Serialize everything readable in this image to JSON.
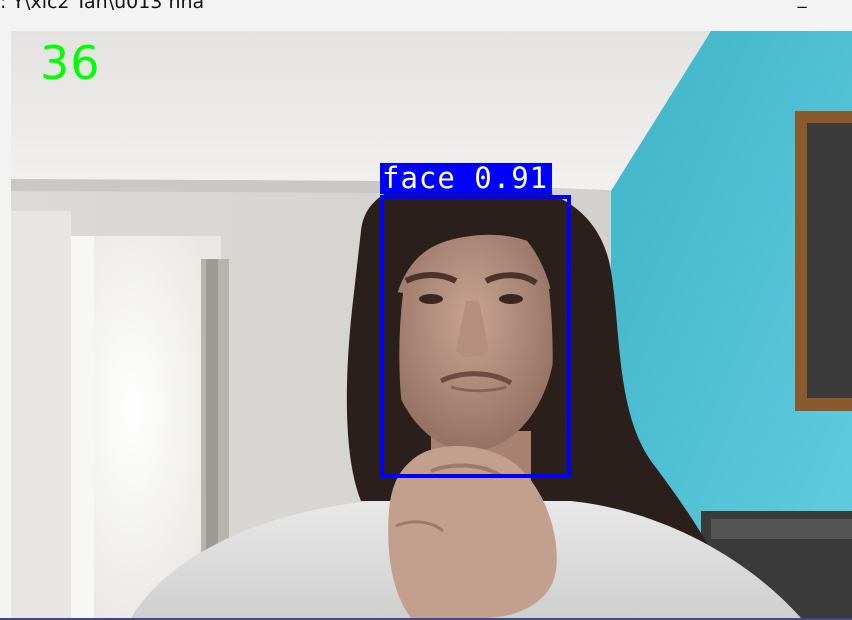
{
  "window": {
    "title": ": Y\\xic2 Tan\\u013 nna",
    "minimize_glyph": "_"
  },
  "overlay": {
    "fps": "36",
    "fps_color": "#00ff00",
    "detection": {
      "label": "face 0.91",
      "box_color": "#0000ff"
    }
  }
}
